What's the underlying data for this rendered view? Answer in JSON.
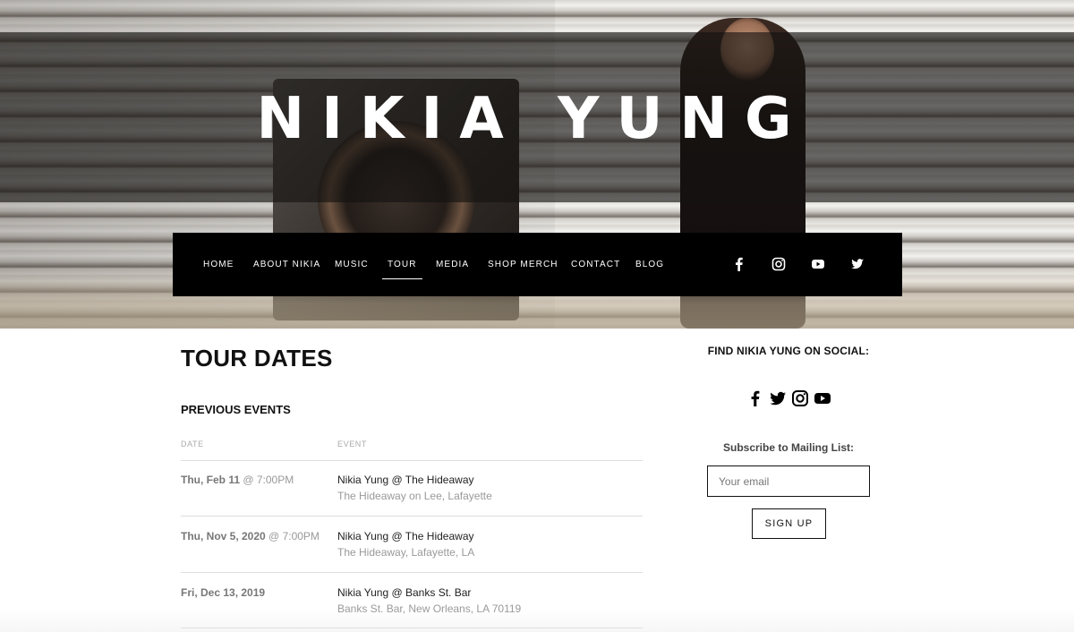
{
  "hero": {
    "title": "NIKIA YUNG"
  },
  "nav": {
    "items": [
      {
        "label": "HOME"
      },
      {
        "label": "ABOUT NIKIA"
      },
      {
        "label": "MUSIC"
      },
      {
        "label": "TOUR",
        "active": true
      },
      {
        "label": "MEDIA"
      },
      {
        "label": "SHOP MERCH"
      },
      {
        "label": "CONTACT"
      },
      {
        "label": "BLOG"
      }
    ],
    "social_icons": [
      "facebook-icon",
      "instagram-icon",
      "youtube-icon",
      "twitter-icon"
    ]
  },
  "main": {
    "page_title": "TOUR DATES",
    "section_title": "PREVIOUS EVENTS",
    "columns": {
      "date": "DATE",
      "event": "EVENT"
    },
    "events": [
      {
        "date": "Thu, Feb 11",
        "time": "@ 7:00PM",
        "title": "Nikia Yung @ The Hideaway",
        "venue": "The Hideaway on Lee, Lafayette"
      },
      {
        "date": "Thu, Nov 5, 2020",
        "time": "@ 7:00PM",
        "title": "Nikia Yung @ The Hideaway",
        "venue": "The Hideaway, Lafayette, LA"
      },
      {
        "date": "Fri, Dec 13, 2019",
        "time": "",
        "title": "Nikia Yung @ Banks St. Bar",
        "venue": "Banks St. Bar, New Orleans, LA 70119"
      }
    ]
  },
  "sidebar": {
    "social_heading": "FIND NIKIA YUNG ON SOCIAL:",
    "social_icons": [
      "facebook-icon",
      "twitter-icon",
      "instagram-icon",
      "youtube-icon"
    ],
    "subscribe_label": "Subscribe to Mailing List:",
    "email_placeholder": "Your email",
    "signup_label": "SIGN UP"
  },
  "colors": {
    "nav_background": "#000000",
    "text": "#111111",
    "muted": "#999999"
  }
}
